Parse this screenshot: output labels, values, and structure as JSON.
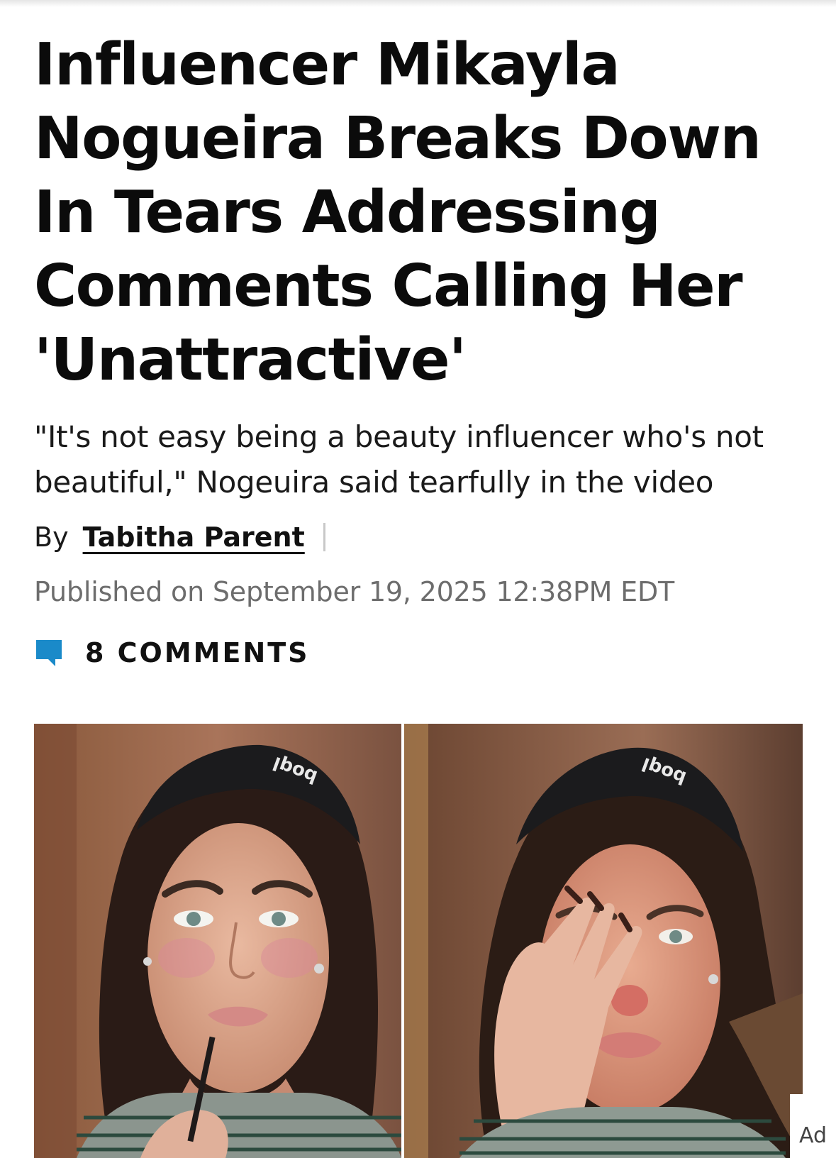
{
  "article": {
    "headline": "Influencer Mikayla Nogueira Breaks Down In Tears Addressing Comments Calling Her 'Unattractive'",
    "subhead": "\"It's not easy being a beauty influencer who's not beautiful,\" Nogeuira said tearfully in the video",
    "byline_prefix": "By",
    "author": "Tabitha Parent",
    "published": "Published on September 19, 2025 12:38PM EDT",
    "comments_label": "8 COMMENTS",
    "image_headband_text": "boql"
  },
  "ad": {
    "label": "Ad"
  },
  "colors": {
    "comment_icon": "#1a8ac9",
    "headline": "#0b0b0b",
    "meta_gray": "#6d6d6d"
  }
}
